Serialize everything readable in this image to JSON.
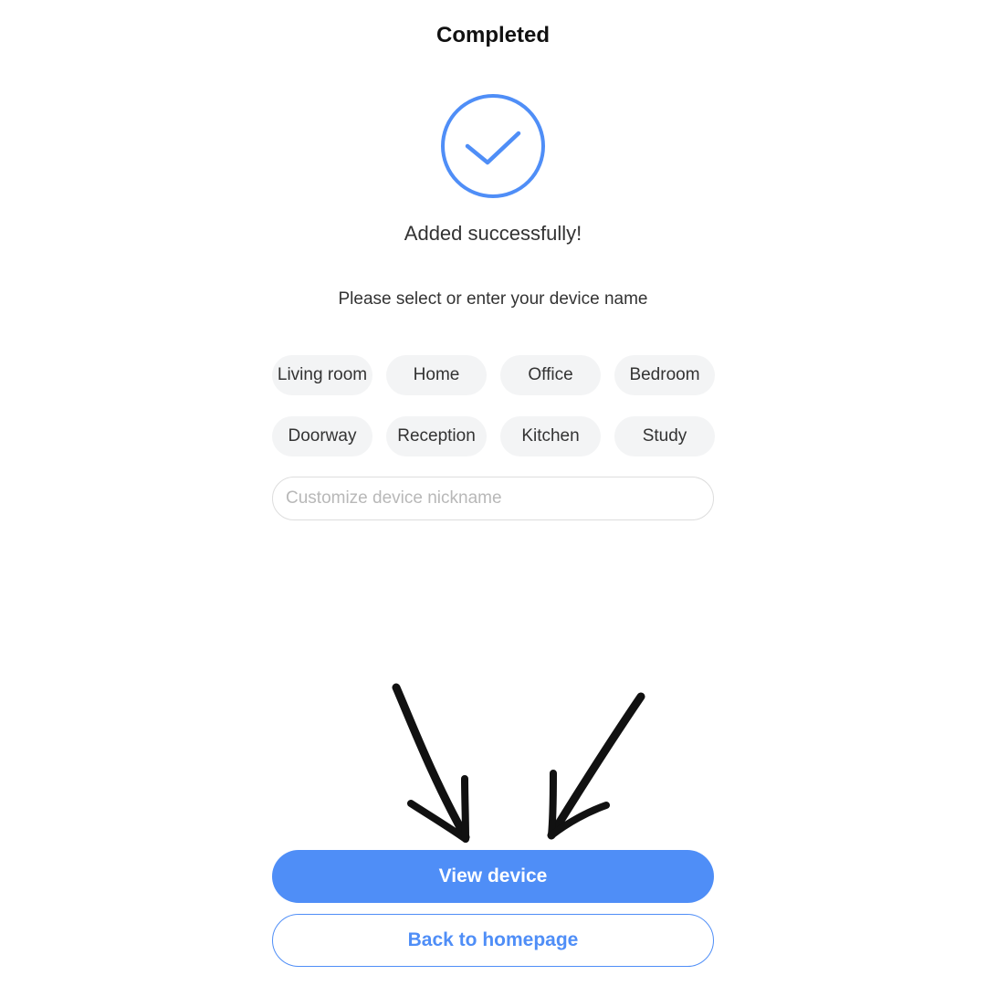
{
  "header": {
    "title": "Completed"
  },
  "status": {
    "icon": "check-circle-icon",
    "accent_color": "#4f8ef7",
    "message": "Added successfully!"
  },
  "naming": {
    "prompt": "Please select or enter your device name",
    "options": [
      "Living room",
      "Home",
      "Office",
      "Bedroom",
      "Doorway",
      "Reception",
      "Kitchen",
      "Study"
    ],
    "nickname_value": "",
    "nickname_placeholder": "Customize device nickname"
  },
  "annotation": {
    "icon": "hand-drawn-arrows",
    "color": "#111111"
  },
  "actions": {
    "primary_label": "View device",
    "secondary_label": "Back to homepage",
    "primary_color": "#4f8ef7"
  }
}
